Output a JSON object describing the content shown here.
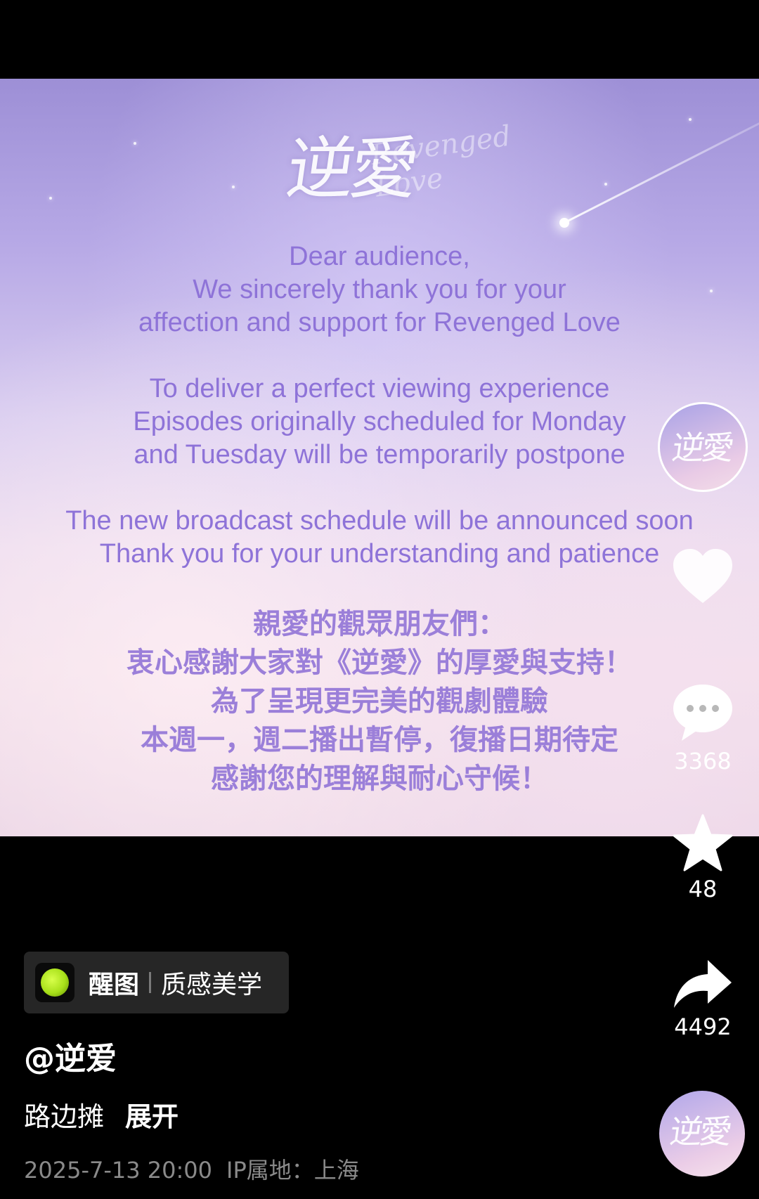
{
  "poster": {
    "logo_title": "逆愛",
    "logo_subtitle": "Revenged Love",
    "english_lines": [
      "Dear audience,",
      "We sincerely thank you for your",
      "affection and support for Revenged Love",
      "",
      "To deliver a perfect viewing experience",
      "Episodes originally scheduled for Monday",
      "and Tuesday will be temporarily postpone",
      "",
      "The new broadcast schedule will be announced soon",
      "Thank you for your understanding and patience"
    ],
    "chinese_lines": [
      "親愛的觀眾朋友們：",
      "衷心感謝大家對《逆愛》的厚愛與支持！",
      "為了呈現更完美的觀劇體驗",
      "本週一，週二播出暫停，復播日期待定",
      "感謝您的理解與耐心守候！"
    ]
  },
  "rail": {
    "avatar_mark": "逆愛",
    "like_count": "",
    "comment_count": "3368",
    "favorite_count": "48",
    "share_count": "4492"
  },
  "info": {
    "tag_name": "醒图",
    "tag_label": "质感美学",
    "author": "@逆爱",
    "caption": "路边摊",
    "expand_label": "展开",
    "date": "2025-7-13 20:00",
    "ip_location": "IP属地：上海"
  },
  "colors": {
    "background": "#000000",
    "poster_text": "#8e73d8",
    "tag_bg": "#262626",
    "meta_text": "#8a8a8a"
  }
}
